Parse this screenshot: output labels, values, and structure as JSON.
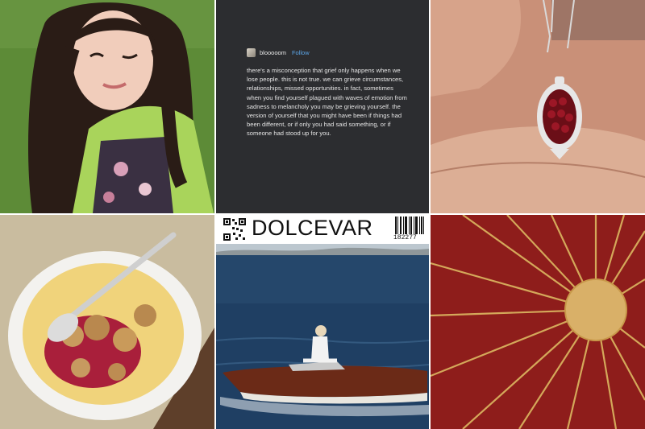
{
  "post": {
    "username": "blooooom",
    "follow_label": "Follow",
    "body": "there's a misconception that grief only happens when we lose people. this is not true. we can grieve circumstances, relationships, missed opportunities. in fact, sometimes when you find yourself plagued with waves of emotion from sadness to melancholy you may be grieving yourself. the version of yourself that you might have been if things had been different, or if only you had said something, or if someone had stood up for you."
  },
  "magazine": {
    "brand": "DOLCEVAR",
    "barcode_number": "182277"
  },
  "colors": {
    "post_background": "#2c2d30",
    "follow_link": "#5ba4e6",
    "sun_background": "#8e1d1b",
    "sun_gold": "#d4a85a"
  }
}
